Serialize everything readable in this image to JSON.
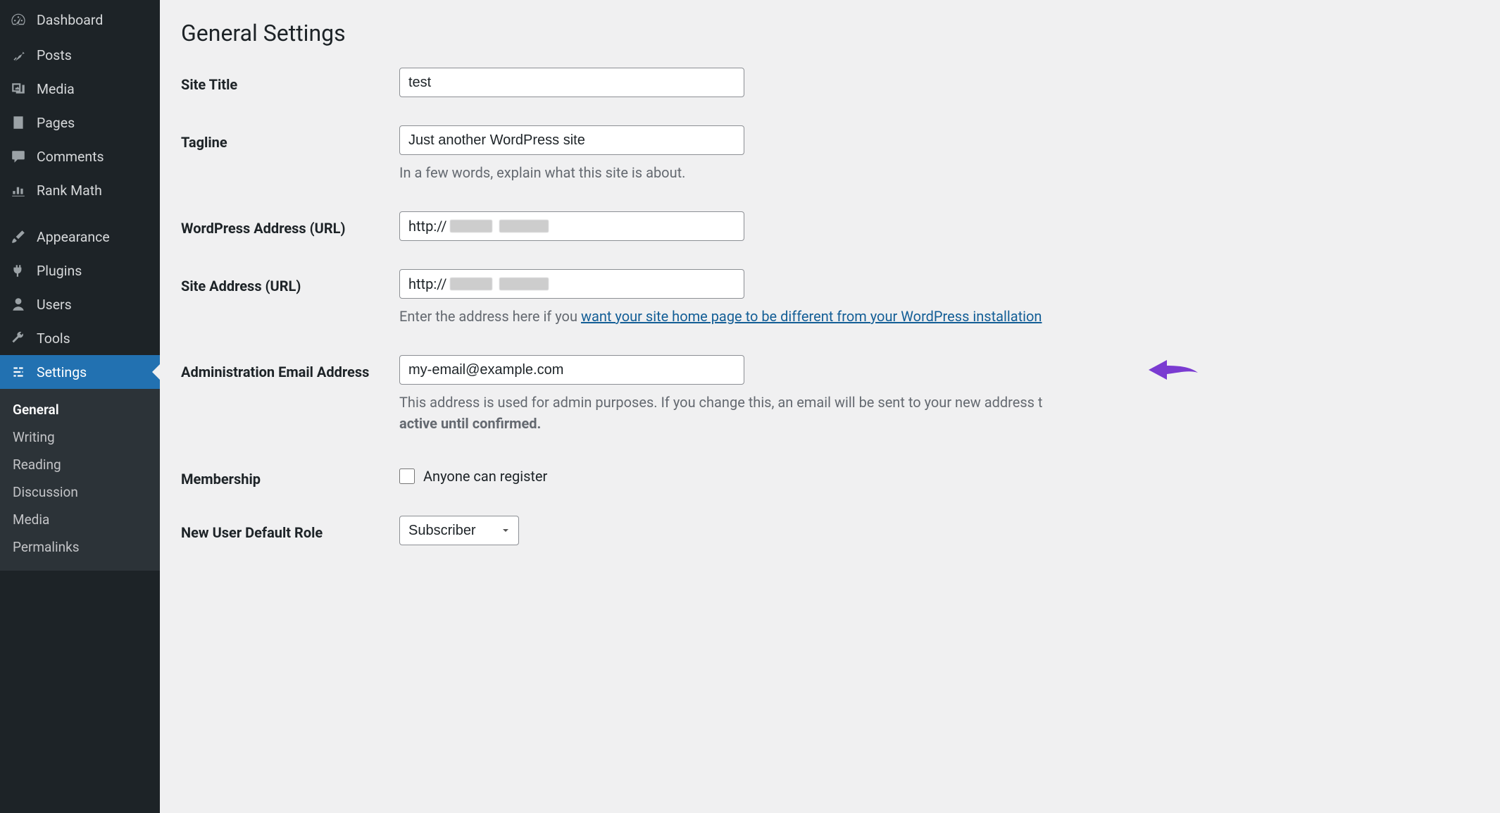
{
  "sidebar": {
    "items": [
      {
        "label": "Dashboard",
        "icon": "dashboard-icon"
      },
      {
        "label": "Posts",
        "icon": "pin-icon"
      },
      {
        "label": "Media",
        "icon": "media-icon"
      },
      {
        "label": "Pages",
        "icon": "page-icon"
      },
      {
        "label": "Comments",
        "icon": "comment-icon"
      },
      {
        "label": "Rank Math",
        "icon": "chart-icon"
      },
      {
        "label": "Appearance",
        "icon": "brush-icon"
      },
      {
        "label": "Plugins",
        "icon": "plugin-icon"
      },
      {
        "label": "Users",
        "icon": "user-icon"
      },
      {
        "label": "Tools",
        "icon": "wrench-icon"
      },
      {
        "label": "Settings",
        "icon": "sliders-icon"
      }
    ],
    "submenu": [
      {
        "label": "General"
      },
      {
        "label": "Writing"
      },
      {
        "label": "Reading"
      },
      {
        "label": "Discussion"
      },
      {
        "label": "Media"
      },
      {
        "label": "Permalinks"
      }
    ]
  },
  "page": {
    "title": "General Settings"
  },
  "form": {
    "site_title": {
      "label": "Site Title",
      "value": "test"
    },
    "tagline": {
      "label": "Tagline",
      "value": "Just another WordPress site",
      "description": "In a few words, explain what this site is about."
    },
    "wp_address": {
      "label": "WordPress Address (URL)",
      "prefix": "http://"
    },
    "site_address": {
      "label": "Site Address (URL)",
      "prefix": "http://",
      "description_pre": "Enter the address here if you ",
      "description_link": "want your site home page to be different from your WordPress installation"
    },
    "admin_email": {
      "label": "Administration Email Address",
      "value": "my-email@example.com",
      "description_pre": "This address is used for admin purposes. If you change this, an email will be sent to your new address t",
      "description_bold": "active until confirmed."
    },
    "membership": {
      "label": "Membership",
      "checkbox_label": "Anyone can register",
      "checked": false
    },
    "default_role": {
      "label": "New User Default Role",
      "value": "Subscriber"
    }
  },
  "colors": {
    "accent": "#2271b1",
    "annotation": "#7a3bd1"
  }
}
